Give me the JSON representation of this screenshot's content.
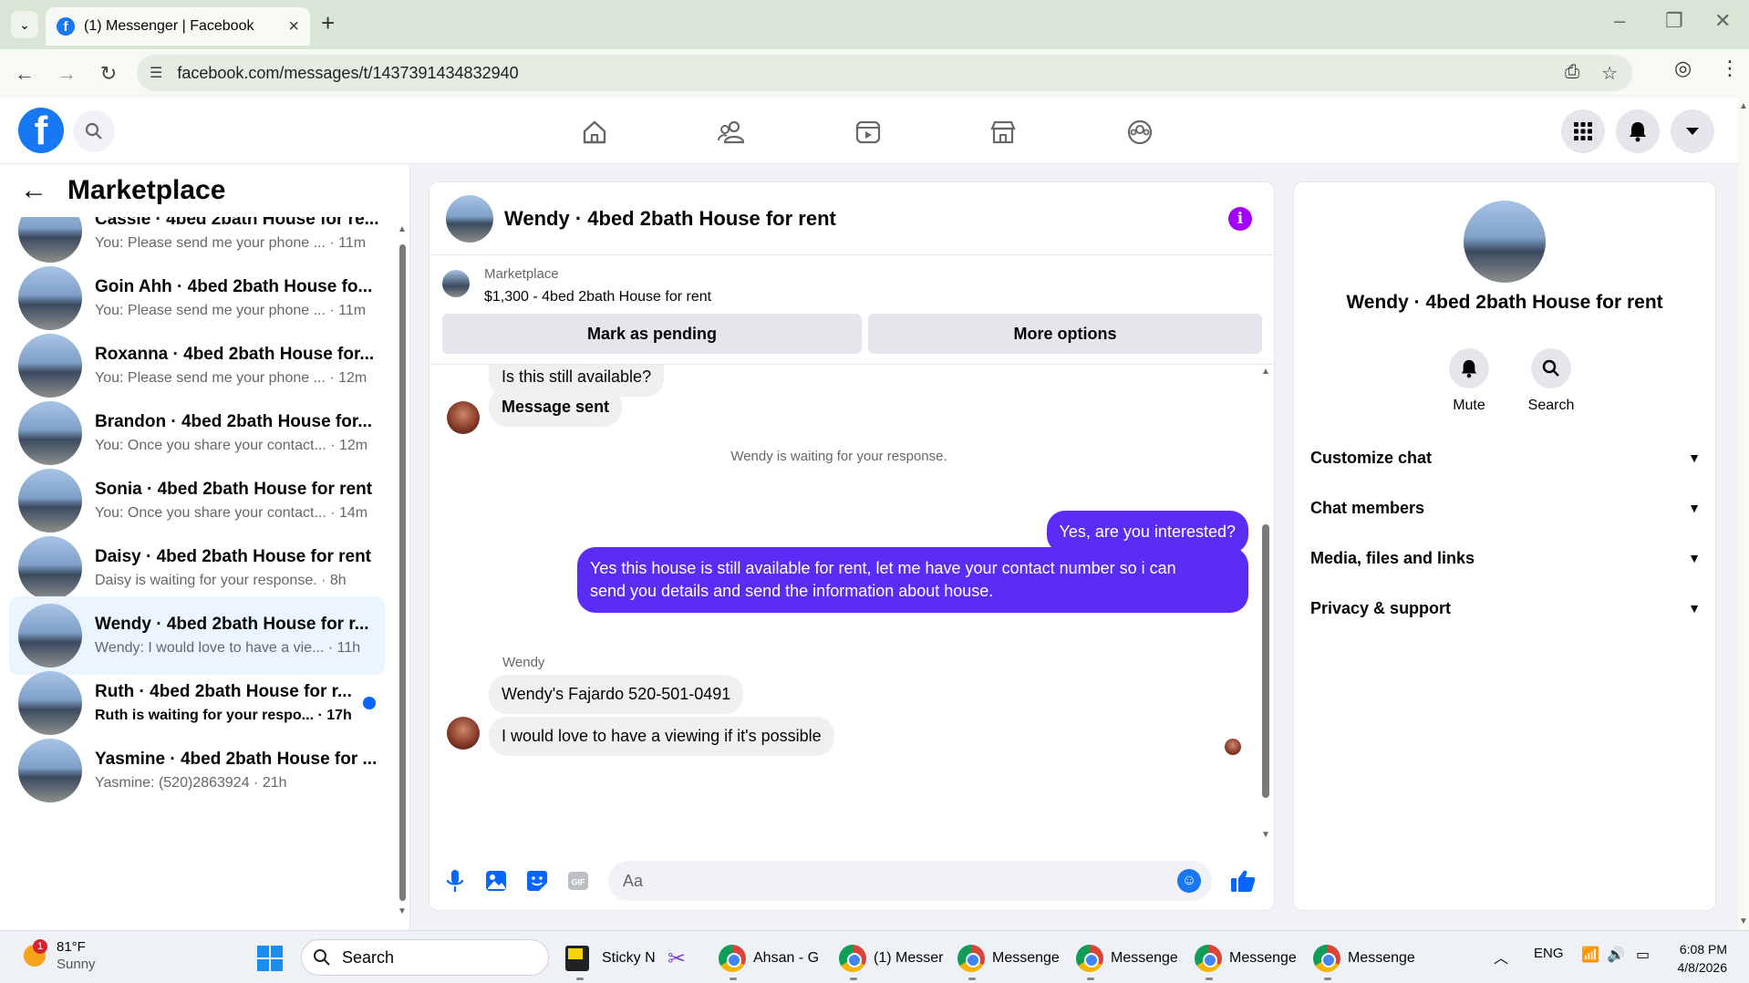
{
  "browser": {
    "tab_title": "(1) Messenger | Facebook",
    "url": "facebook.com/messages/t/1437391434832940"
  },
  "left_panel": {
    "title": "Marketplace",
    "conversations": [
      {
        "name": "Cassie · 4bed 2bath House for re...",
        "preview": "You: Please send me your phone ... · 11m",
        "active": false,
        "unread": false
      },
      {
        "name": "Goin Ahh · 4bed 2bath House fo...",
        "preview": "You: Please send me your phone ... · 11m",
        "active": false,
        "unread": false
      },
      {
        "name": "Roxanna · 4bed 2bath House for...",
        "preview": "You: Please send me your phone ... · 12m",
        "active": false,
        "unread": false
      },
      {
        "name": "Brandon · 4bed 2bath House for...",
        "preview": "You: Once you share your contact... · 12m",
        "active": false,
        "unread": false
      },
      {
        "name": "Sonia · 4bed 2bath House for rent",
        "preview": "You: Once you share your contact... · 14m",
        "active": false,
        "unread": false
      },
      {
        "name": "Daisy · 4bed 2bath House for rent",
        "preview": "Daisy is waiting for your response. · 8h",
        "active": false,
        "unread": false
      },
      {
        "name": "Wendy · 4bed 2bath House for r...",
        "preview": "Wendy: I would love to have a vie... · 11h",
        "active": true,
        "unread": false
      },
      {
        "name": "Ruth · 4bed 2bath House for r...",
        "preview": "Ruth is waiting for your respo... · 17h",
        "active": false,
        "unread": true
      },
      {
        "name": "Yasmine · 4bed 2bath House for ...",
        "preview": "Yasmine: (520)2863924 · 21h",
        "active": false,
        "unread": false
      }
    ]
  },
  "chat": {
    "title": "Wendy · 4bed 2bath House for rent",
    "marketplace_label": "Marketplace",
    "listing": "$1,300 - 4bed 2bath House for rent",
    "pending_btn": "Mark as pending",
    "options_btn": "More options",
    "msg_available": "Is this still available?",
    "msg_sent": "Message sent",
    "status": "Wendy is waiting for your response.",
    "out_1": "Yes, are you interested?",
    "out_2_line1": "Yes this house is still available for rent, let me have your contact number so i can",
    "out_2_line2": "send you details and send the information about house.",
    "sender": "Wendy",
    "in_1": "Wendy's Fajardo 520-501-0491",
    "in_2": "I would love to have a viewing if it's possible",
    "composer_placeholder": "Aa"
  },
  "info_panel": {
    "name": "Wendy · 4bed 2bath House for rent",
    "mute": "Mute",
    "search": "Search",
    "sections": [
      "Customize chat",
      "Chat members",
      "Media, files and links",
      "Privacy & support"
    ]
  },
  "taskbar": {
    "temp": "81°F",
    "weather": "Sunny",
    "weather_badge": "1",
    "search": "Search",
    "apps": [
      "Sticky N",
      "Ahsan - G",
      "(1) Messer",
      "Messenge",
      "Messenge",
      "Messenge",
      "Messenge"
    ],
    "lang": "ENG",
    "time": "6:08 PM",
    "date": "4/8/2026"
  }
}
